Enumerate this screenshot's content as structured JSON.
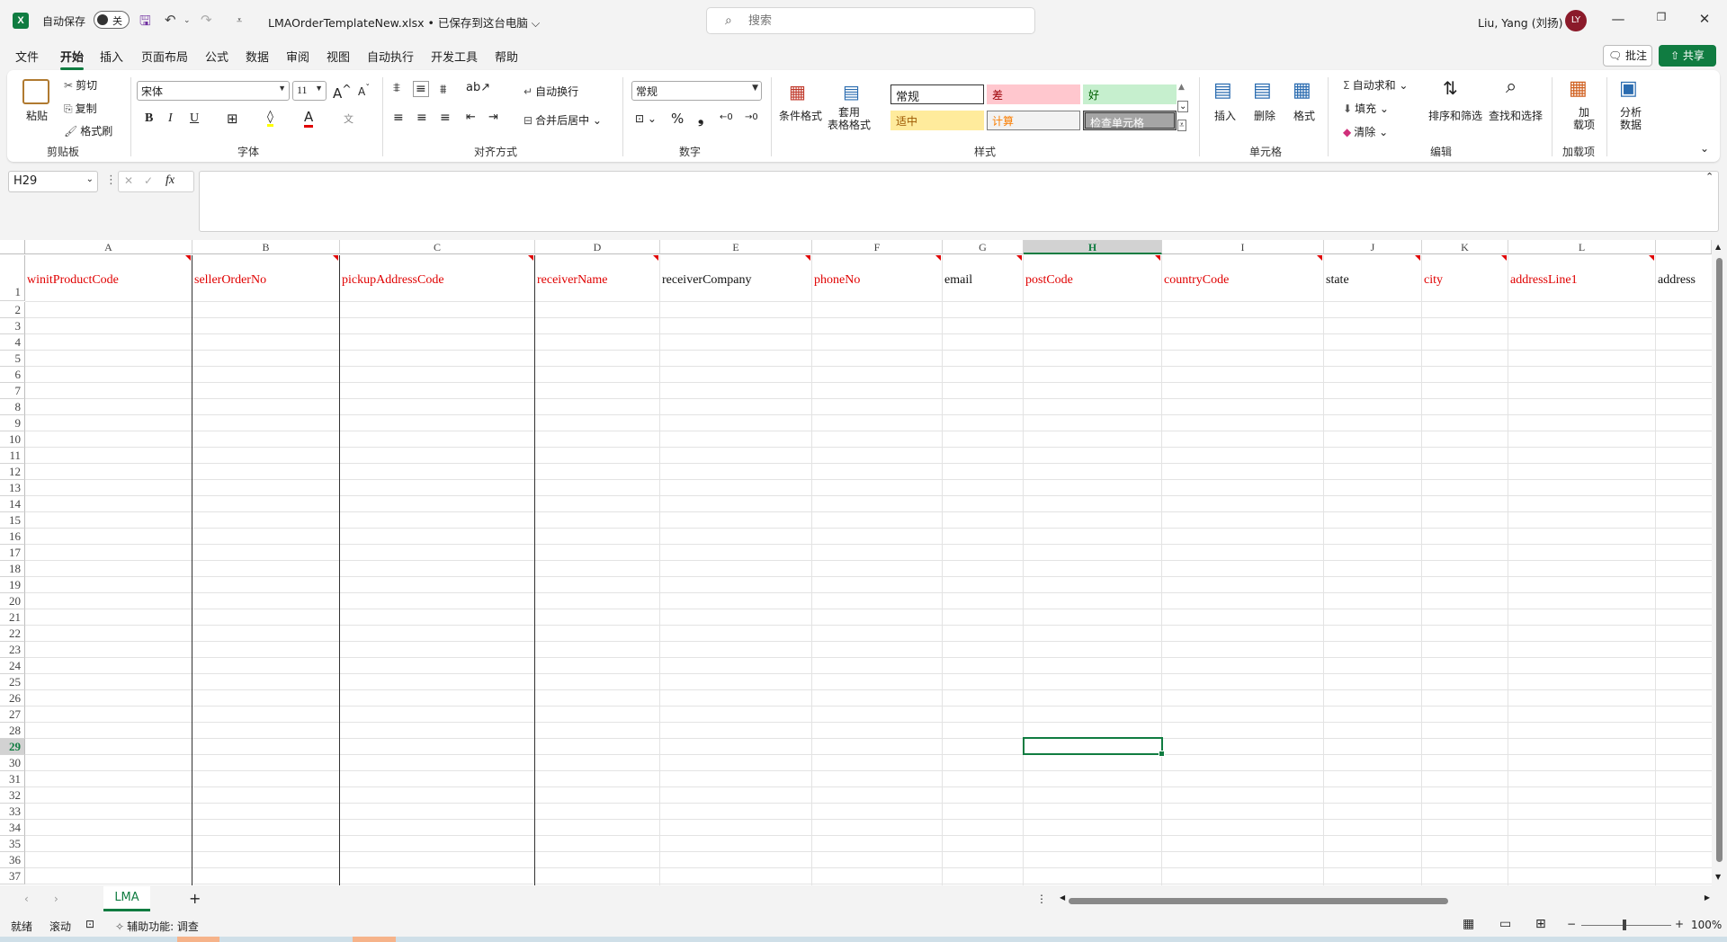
{
  "titlebar": {
    "logo": "X",
    "autosave_label": "自动保存",
    "autosave_state": "关",
    "filename": "LMAOrderTemplateNew.xlsx • 已保存到这台电脑 ⌵",
    "search_placeholder": "搜索",
    "user_name": "Liu, Yang (刘扬)",
    "avatar_initials": "LY"
  },
  "menu": {
    "items": [
      "文件",
      "开始",
      "插入",
      "页面布局",
      "公式",
      "数据",
      "审阅",
      "视图",
      "自动执行",
      "开发工具",
      "帮助"
    ],
    "comment_label": "🗨 批注",
    "share_label": "⇧ 共享"
  },
  "ribbon": {
    "clipboard": {
      "paste": "粘贴",
      "cut": "剪切",
      "copy": "复制",
      "format_painter": "格式刷",
      "label": "剪贴板"
    },
    "font": {
      "name": "宋体",
      "size": "11",
      "label": "字体",
      "bold": "B",
      "italic": "I",
      "underline": "U"
    },
    "alignment": {
      "wrap": "自动换行",
      "merge": "合并后居中",
      "label": "对齐方式"
    },
    "number": {
      "format": "常规",
      "label": "数字",
      "percent": "%",
      "comma": "❟"
    },
    "styles": {
      "conditional": "条件格式",
      "table_format": "套用\n表格格式",
      "cells": [
        "常规",
        "差",
        "好",
        "适中",
        "计算",
        "检查单元格"
      ],
      "label": "样式"
    },
    "cells": {
      "insert": "插入",
      "delete": "删除",
      "format": "格式",
      "label": "单元格"
    },
    "editing": {
      "autosum": "自动求和",
      "fill": "填充",
      "clear": "清除",
      "sort": "排序和筛选",
      "find": "查找和选择",
      "label": "编辑"
    },
    "addins": {
      "addins": "加\n载项",
      "label": "加载项"
    },
    "analyze": {
      "label": "分析\n数据"
    }
  },
  "formula_bar": {
    "name_box": "H29",
    "fx": "fx",
    "cancel": "✕",
    "confirm": "✓",
    "formula": ""
  },
  "sheet": {
    "columns": [
      "A",
      "B",
      "C",
      "D",
      "E",
      "F",
      "G",
      "H",
      "I",
      "J",
      "K",
      "L",
      ""
    ],
    "headers": [
      "winitProductCode",
      "sellerOrderNo",
      "pickupAddressCode",
      "receiverName",
      "receiverCompany",
      "phoneNo",
      "email",
      "postCode",
      "countryCode",
      "state",
      "city",
      "addressLine1",
      "address"
    ],
    "required": [
      true,
      true,
      true,
      true,
      false,
      true,
      false,
      true,
      true,
      false,
      true,
      true,
      false
    ],
    "rows": [
      "1",
      "2",
      "3",
      "4",
      "5",
      "6",
      "7",
      "8",
      "9",
      "10",
      "11",
      "12",
      "13",
      "14",
      "15",
      "16",
      "17",
      "18",
      "19",
      "20",
      "21",
      "22",
      "23",
      "24",
      "25",
      "26",
      "27",
      "28",
      "29",
      "30",
      "31",
      "32",
      "33",
      "34",
      "35",
      "36",
      "37"
    ],
    "selected_cell": "H29",
    "tab_name": "LMA"
  },
  "status": {
    "ready": "就绪",
    "scroll": "滚动",
    "accessibility": "辅助功能: 调查",
    "zoom": "100%"
  }
}
